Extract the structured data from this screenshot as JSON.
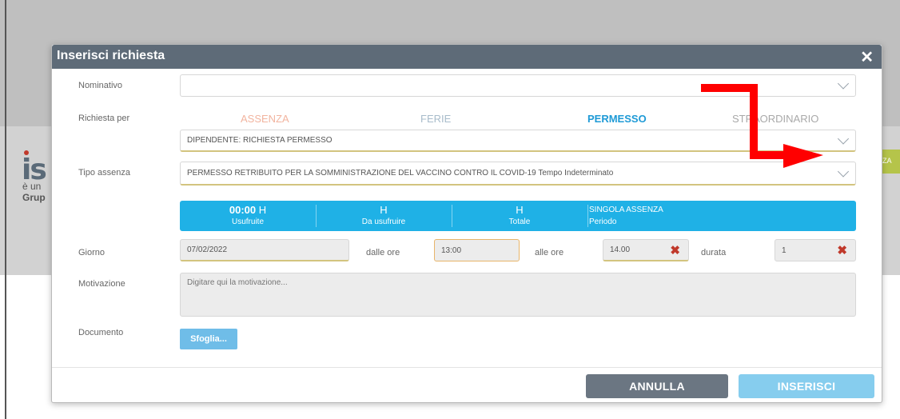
{
  "background": {
    "logo_text": "is",
    "line1": "è un",
    "line2": "Grup",
    "right_badge": "ZA"
  },
  "dialog": {
    "title": "Inserisci richiesta",
    "close_icon": "close-icon"
  },
  "form": {
    "nominativo": {
      "label": "Nominativo",
      "value": ""
    },
    "richiesta_per": {
      "label": "Richiesta per",
      "options": [
        {
          "label": "ASSENZA",
          "color": "#f2b49f"
        },
        {
          "label": "FERIE",
          "color": "#a8bccb"
        },
        {
          "label": "PERMESSO",
          "color": "#1e9ad6",
          "selected": true
        },
        {
          "label": "STRAORDINARIO",
          "color": "#a9a9a9"
        }
      ],
      "subtype": "DIPENDENTE: RICHIESTA PERMESSO"
    },
    "tipo_assenza": {
      "label": "Tipo assenza",
      "value": "PERMESSO RETRIBUITO PER LA SOMMINISTRAZIONE DEL VACCINO CONTRO IL COVID-19 Tempo Indeterminato"
    },
    "summary": {
      "usufruite_value": "00:00",
      "usufruite_unit": "H",
      "usufruite_label": "Usufruite",
      "da_usufruire_unit": "H",
      "da_usufruire_label": "Da usufruire",
      "totale_unit": "H",
      "totale_label": "Totale",
      "singola_label": "SINGOLA ASSENZA",
      "periodo_label": "Periodo"
    },
    "giorno": {
      "label": "Giorno",
      "value": "07/02/2022"
    },
    "dalle_ore": {
      "label": "dalle ore",
      "value": "13:00"
    },
    "alle_ore": {
      "label": "alle ore",
      "value": "14.00"
    },
    "durata": {
      "label": "durata",
      "value": "1"
    },
    "motivazione": {
      "label": "Motivazione",
      "placeholder": "Digitare qui la motivazione..."
    },
    "documento": {
      "label": "Documento",
      "browse_label": "Sfoglia..."
    }
  },
  "footer": {
    "cancel_label": "ANNULLA",
    "insert_label": "INSERISCI"
  },
  "annotation": {
    "arrow_color": "#ff0000"
  }
}
